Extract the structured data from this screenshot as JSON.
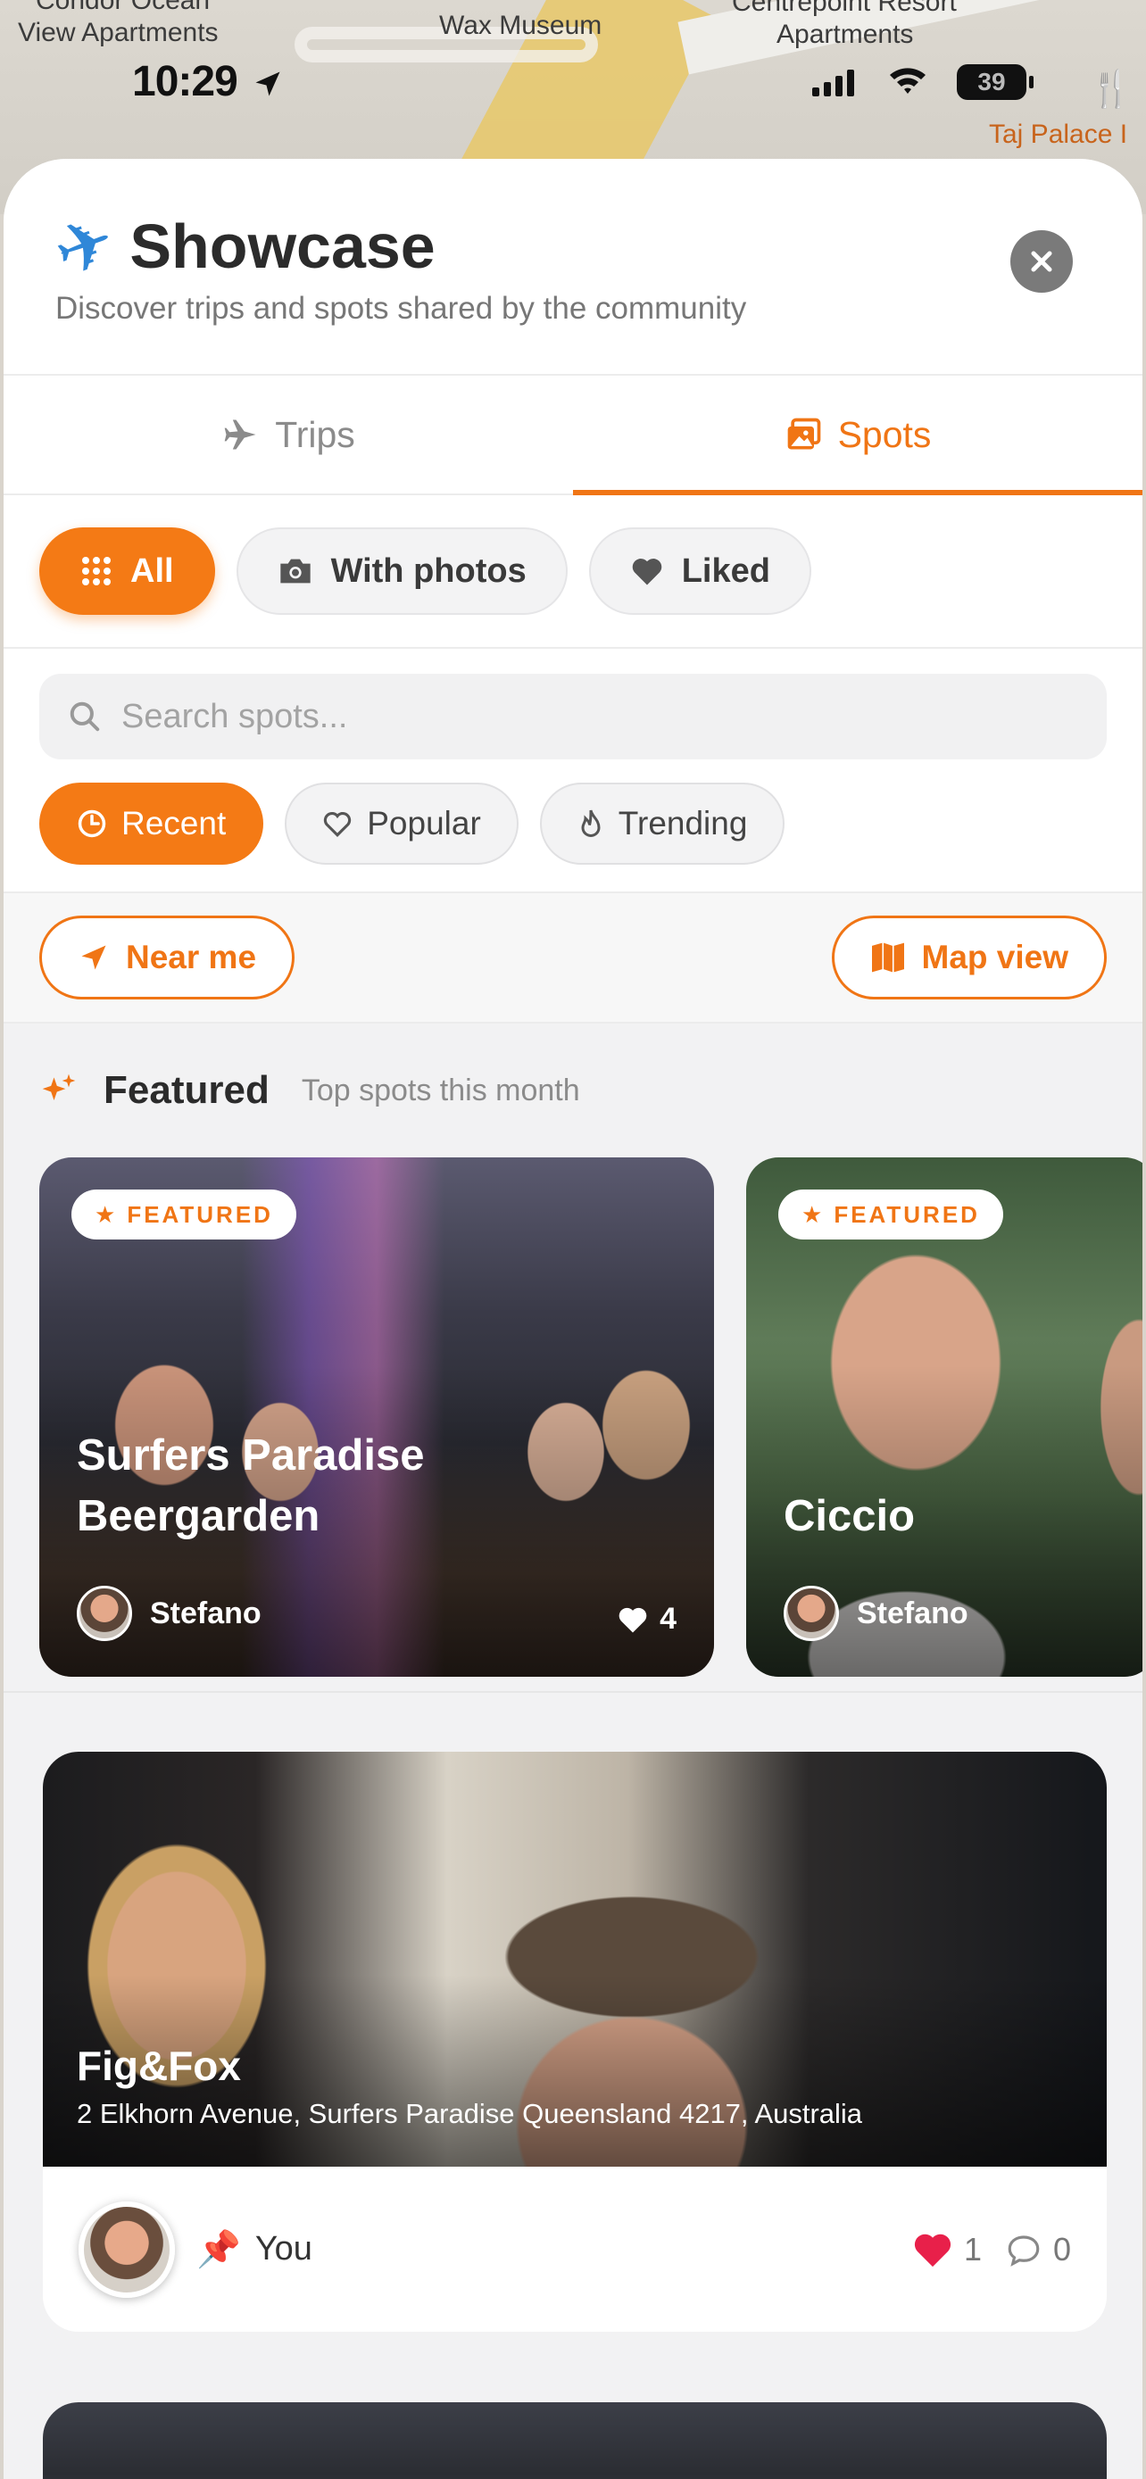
{
  "map": {
    "labels": [
      "Condor Ocean",
      "View Apartments",
      "Wax Museum",
      "Centrepoint Resort",
      "Apartments",
      "Taj Palace I"
    ]
  },
  "status_bar": {
    "time": "10:29",
    "battery": "39"
  },
  "header": {
    "title": "Showcase",
    "subtitle": "Discover trips and spots shared by the community"
  },
  "tabs": [
    {
      "label": "Trips",
      "icon": "plane-icon",
      "active": false
    },
    {
      "label": "Spots",
      "icon": "photos-icon",
      "active": true
    }
  ],
  "filters": {
    "all": "All",
    "with_photos": "With photos",
    "liked": "Liked"
  },
  "search": {
    "placeholder": "Search spots..."
  },
  "sort": {
    "recent": "Recent",
    "popular": "Popular",
    "trending": "Trending"
  },
  "actions": {
    "near_me": "Near me",
    "map_view": "Map view"
  },
  "featured": {
    "title": "Featured",
    "subtitle": "Top spots this month",
    "badge": "FEATURED",
    "cards": [
      {
        "name": "Surfers Paradise Beergarden",
        "owner": "Stefano",
        "likes": "4"
      },
      {
        "name": "Ciccio",
        "owner": "Stefano",
        "likes": ""
      }
    ]
  },
  "spots": [
    {
      "name": "Fig&Fox",
      "address": "2 Elkhorn Avenue, Surfers Paradise Queensland 4217, Australia",
      "owner": "You",
      "likes": "1",
      "comments": "0"
    }
  ],
  "colors": {
    "accent": "#f47a15",
    "like_red": "#e8204a"
  }
}
